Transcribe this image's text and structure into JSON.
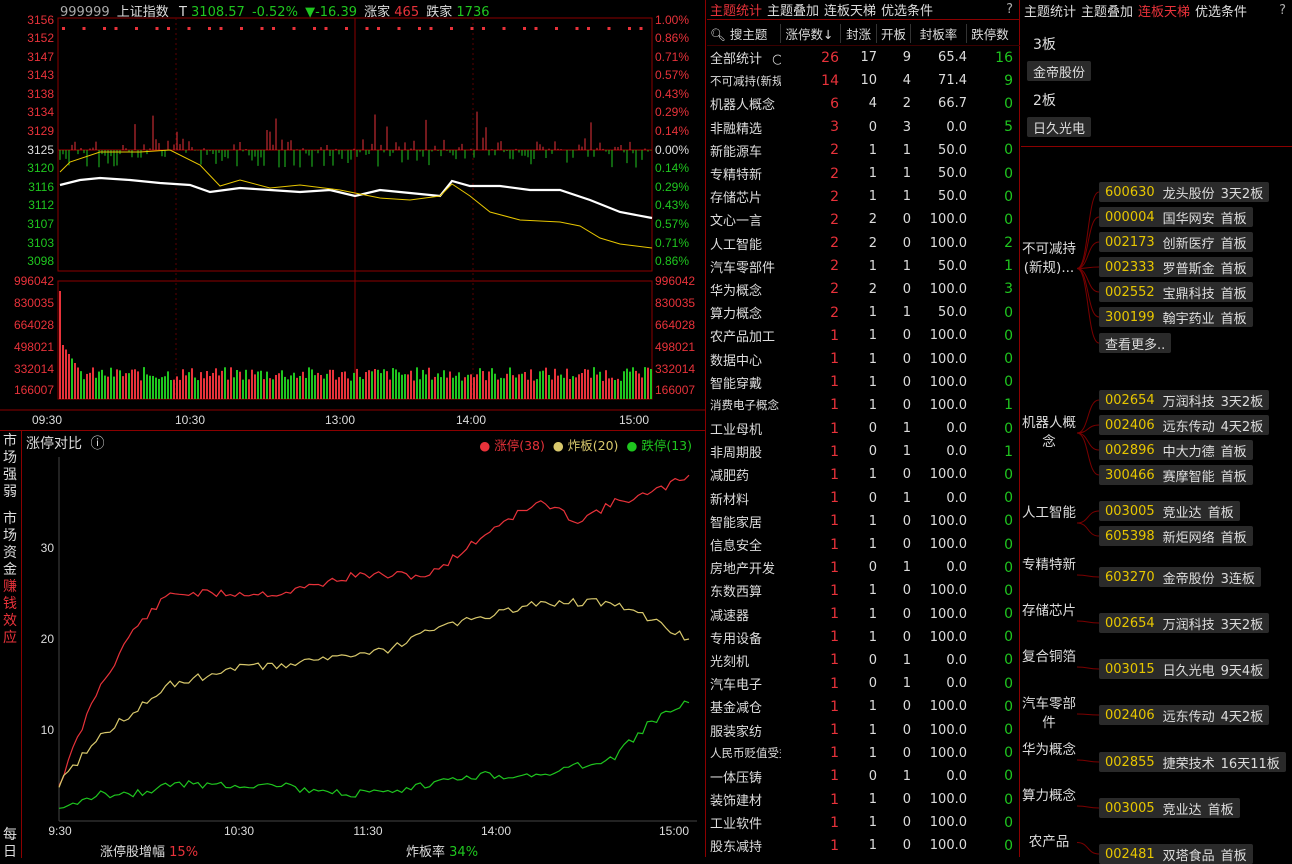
{
  "index_header": {
    "code": "999999",
    "name": "上证指数",
    "t": "T",
    "price": "3108.57",
    "pct": "-0.52%",
    "change": "▼-16.39",
    "up_label": "涨家",
    "up_count": "465",
    "down_label": "跌家",
    "down_count": "1736"
  },
  "price_axis_left": [
    "3156",
    "3152",
    "3147",
    "3143",
    "3138",
    "3134",
    "3129",
    "3125",
    "3120",
    "3116",
    "3112",
    "3107",
    "3103",
    "3098"
  ],
  "price_axis_right": [
    "1.00%",
    "0.86%",
    "0.71%",
    "0.57%",
    "0.43%",
    "0.29%",
    "0.14%",
    "0.00%",
    "0.14%",
    "0.29%",
    "0.43%",
    "0.57%",
    "0.71%",
    "0.86%"
  ],
  "volume_axis": [
    "996042",
    "830035",
    "664028",
    "498021",
    "332014",
    "166007"
  ],
  "time_axis": [
    "09:30",
    "10:30",
    "13:00",
    "14:00",
    "15:00"
  ],
  "compare_panel": {
    "side_tabs": [
      "市场强弱",
      "市场资金",
      "赚钱效应",
      "每日"
    ],
    "title": "涨停对比",
    "info_icon": "ⓘ",
    "legend": [
      {
        "label": "涨停(38)",
        "color": "#e8323a"
      },
      {
        "label": "炸板(20)",
        "color": "#d8c86c"
      },
      {
        "label": "跌停(13)",
        "color": "#1fc61f"
      }
    ],
    "y_ticks": [
      "30",
      "20",
      "10"
    ],
    "x_ticks": [
      "9:30",
      "10:30",
      "11:30",
      "14:00",
      "15:00"
    ],
    "footer_left_label": "涨停股增幅",
    "footer_left_value": "15%",
    "footer_right_label": "炸板率",
    "footer_right_value": "34%"
  },
  "chart_data": {
    "type": "line",
    "x": [
      "9:30",
      "9:45",
      "10:00",
      "10:15",
      "10:30",
      "10:45",
      "11:00",
      "11:15",
      "11:30",
      "13:00",
      "13:15",
      "13:30",
      "13:45",
      "14:00",
      "14:15",
      "14:30",
      "14:45",
      "15:00"
    ],
    "series": [
      {
        "name": "涨停(38)",
        "color": "#e8323a",
        "values": [
          4,
          14,
          21,
          25,
          25,
          25,
          25,
          26,
          27,
          27,
          27,
          30,
          33,
          35,
          33,
          35,
          36,
          38
        ]
      },
      {
        "name": "炸板(20)",
        "color": "#d8c86c",
        "values": [
          4,
          9,
          12,
          15,
          16,
          17,
          17,
          18,
          18,
          19,
          21,
          22,
          23,
          24,
          24,
          24,
          22,
          20
        ]
      },
      {
        "name": "跌停(13)",
        "color": "#1fc61f",
        "values": [
          1,
          3,
          3,
          4,
          4,
          4,
          4,
          3,
          3,
          3,
          4,
          5,
          5,
          5,
          6,
          7,
          11,
          13
        ]
      }
    ],
    "ylim": [
      0,
      40
    ],
    "grid": true
  },
  "theme_panel": {
    "tabs": [
      "主题统计",
      "主题叠加",
      "连板天梯",
      "优选条件"
    ],
    "help": "?",
    "search_label": "搜主题",
    "columns": [
      "涨停数↓",
      "封涨",
      "开板",
      "封板率",
      "跌停数"
    ],
    "rows": [
      {
        "name": "全部统计",
        "a": "26",
        "b": "17",
        "c": "9",
        "d": "65.4",
        "e": "16"
      },
      {
        "name": "不可减持(新规)",
        "a": "14",
        "b": "10",
        "c": "4",
        "d": "71.4",
        "e": "9"
      },
      {
        "name": "机器人概念",
        "a": "6",
        "b": "4",
        "c": "2",
        "d": "66.7",
        "e": "0"
      },
      {
        "name": "非融精选",
        "a": "3",
        "b": "0",
        "c": "3",
        "d": "0.0",
        "e": "5"
      },
      {
        "name": "新能源车",
        "a": "2",
        "b": "1",
        "c": "1",
        "d": "50.0",
        "e": "0"
      },
      {
        "name": "专精特新",
        "a": "2",
        "b": "1",
        "c": "1",
        "d": "50.0",
        "e": "0"
      },
      {
        "name": "存储芯片",
        "a": "2",
        "b": "1",
        "c": "1",
        "d": "50.0",
        "e": "0"
      },
      {
        "name": "文心一言",
        "a": "2",
        "b": "2",
        "c": "0",
        "d": "100.0",
        "e": "0"
      },
      {
        "name": "人工智能",
        "a": "2",
        "b": "2",
        "c": "0",
        "d": "100.0",
        "e": "2"
      },
      {
        "name": "汽车零部件",
        "a": "2",
        "b": "1",
        "c": "1",
        "d": "50.0",
        "e": "1"
      },
      {
        "name": "华为概念",
        "a": "2",
        "b": "2",
        "c": "0",
        "d": "100.0",
        "e": "3"
      },
      {
        "name": "算力概念",
        "a": "2",
        "b": "1",
        "c": "1",
        "d": "50.0",
        "e": "0"
      },
      {
        "name": "农产品加工",
        "a": "1",
        "b": "1",
        "c": "0",
        "d": "100.0",
        "e": "0"
      },
      {
        "name": "数据中心",
        "a": "1",
        "b": "1",
        "c": "0",
        "d": "100.0",
        "e": "0"
      },
      {
        "name": "智能穿戴",
        "a": "1",
        "b": "1",
        "c": "0",
        "d": "100.0",
        "e": "0"
      },
      {
        "name": "消费电子概念",
        "a": "1",
        "b": "1",
        "c": "0",
        "d": "100.0",
        "e": "1"
      },
      {
        "name": "工业母机",
        "a": "1",
        "b": "0",
        "c": "1",
        "d": "0.0",
        "e": "0"
      },
      {
        "name": "非周期股",
        "a": "1",
        "b": "0",
        "c": "1",
        "d": "0.0",
        "e": "1"
      },
      {
        "name": "减肥药",
        "a": "1",
        "b": "1",
        "c": "0",
        "d": "100.0",
        "e": "0"
      },
      {
        "name": "新材料",
        "a": "1",
        "b": "0",
        "c": "1",
        "d": "0.0",
        "e": "0"
      },
      {
        "name": "智能家居",
        "a": "1",
        "b": "1",
        "c": "0",
        "d": "100.0",
        "e": "0"
      },
      {
        "name": "信息安全",
        "a": "1",
        "b": "1",
        "c": "0",
        "d": "100.0",
        "e": "0"
      },
      {
        "name": "房地产开发",
        "a": "1",
        "b": "0",
        "c": "1",
        "d": "0.0",
        "e": "0"
      },
      {
        "name": "东数西算",
        "a": "1",
        "b": "1",
        "c": "0",
        "d": "100.0",
        "e": "0"
      },
      {
        "name": "减速器",
        "a": "1",
        "b": "1",
        "c": "0",
        "d": "100.0",
        "e": "0"
      },
      {
        "name": "专用设备",
        "a": "1",
        "b": "1",
        "c": "0",
        "d": "100.0",
        "e": "0"
      },
      {
        "name": "光刻机",
        "a": "1",
        "b": "0",
        "c": "1",
        "d": "0.0",
        "e": "0"
      },
      {
        "name": "汽车电子",
        "a": "1",
        "b": "0",
        "c": "1",
        "d": "0.0",
        "e": "0"
      },
      {
        "name": "基金减仓",
        "a": "1",
        "b": "1",
        "c": "0",
        "d": "100.0",
        "e": "0"
      },
      {
        "name": "服装家纺",
        "a": "1",
        "b": "1",
        "c": "0",
        "d": "100.0",
        "e": "0"
      },
      {
        "name": "人民币贬值受益",
        "a": "1",
        "b": "1",
        "c": "0",
        "d": "100.0",
        "e": "0"
      },
      {
        "name": "一体压铸",
        "a": "1",
        "b": "0",
        "c": "1",
        "d": "0.0",
        "e": "0"
      },
      {
        "name": "装饰建材",
        "a": "1",
        "b": "1",
        "c": "0",
        "d": "100.0",
        "e": "0"
      },
      {
        "name": "工业软件",
        "a": "1",
        "b": "1",
        "c": "0",
        "d": "100.0",
        "e": "0"
      },
      {
        "name": "股东减持",
        "a": "1",
        "b": "1",
        "c": "0",
        "d": "100.0",
        "e": "0"
      }
    ]
  },
  "ladder_panel": {
    "tabs": [
      "主题统计",
      "主题叠加",
      "连板天梯",
      "优选条件"
    ],
    "help": "?",
    "boards": [
      {
        "label": "3板",
        "stock": "金帝股份"
      },
      {
        "label": "2板",
        "stock": "日久光电"
      }
    ],
    "groups": [
      {
        "theme": "不可减持(新规)...",
        "stocks": [
          {
            "code": "600630",
            "name": "龙头股份",
            "status": "3天2板"
          },
          {
            "code": "000004",
            "name": "国华网安",
            "status": "首板"
          },
          {
            "code": "002173",
            "name": "创新医疗",
            "status": "首板"
          },
          {
            "code": "002333",
            "name": "罗普斯金",
            "status": "首板"
          },
          {
            "code": "002552",
            "name": "宝鼎科技",
            "status": "首板"
          },
          {
            "code": "300199",
            "name": "翰宇药业",
            "status": "首板"
          }
        ],
        "more": "查看更多.."
      },
      {
        "theme": "机器人概念",
        "stocks": [
          {
            "code": "002654",
            "name": "万润科技",
            "status": "3天2板"
          },
          {
            "code": "002406",
            "name": "远东传动",
            "status": "4天2板"
          },
          {
            "code": "002896",
            "name": "中大力德",
            "status": "首板"
          },
          {
            "code": "300466",
            "name": "赛摩智能",
            "status": "首板"
          }
        ]
      },
      {
        "theme": "人工智能",
        "stocks": [
          {
            "code": "003005",
            "name": "竞业达",
            "status": "首板"
          },
          {
            "code": "605398",
            "name": "新炬网络",
            "status": "首板"
          }
        ]
      },
      {
        "theme": "专精特新",
        "stocks": [
          {
            "code": "603270",
            "name": "金帝股份",
            "status": "3连板"
          }
        ]
      },
      {
        "theme": "存储芯片",
        "stocks": [
          {
            "code": "002654",
            "name": "万润科技",
            "status": "3天2板"
          }
        ]
      },
      {
        "theme": "复合铜箔",
        "stocks": [
          {
            "code": "003015",
            "name": "日久光电",
            "status": "9天4板"
          }
        ]
      },
      {
        "theme": "汽车零部件",
        "stocks": [
          {
            "code": "002406",
            "name": "远东传动",
            "status": "4天2板"
          }
        ]
      },
      {
        "theme": "华为概念",
        "stocks": [
          {
            "code": "002855",
            "name": "捷荣技术",
            "status": "16天11板"
          }
        ]
      },
      {
        "theme": "算力概念",
        "stocks": [
          {
            "code": "003005",
            "name": "竞业达",
            "status": "首板"
          }
        ]
      },
      {
        "theme": "农产品",
        "stocks": [
          {
            "code": "002481",
            "name": "双塔食品",
            "status": "首板"
          }
        ]
      }
    ]
  }
}
